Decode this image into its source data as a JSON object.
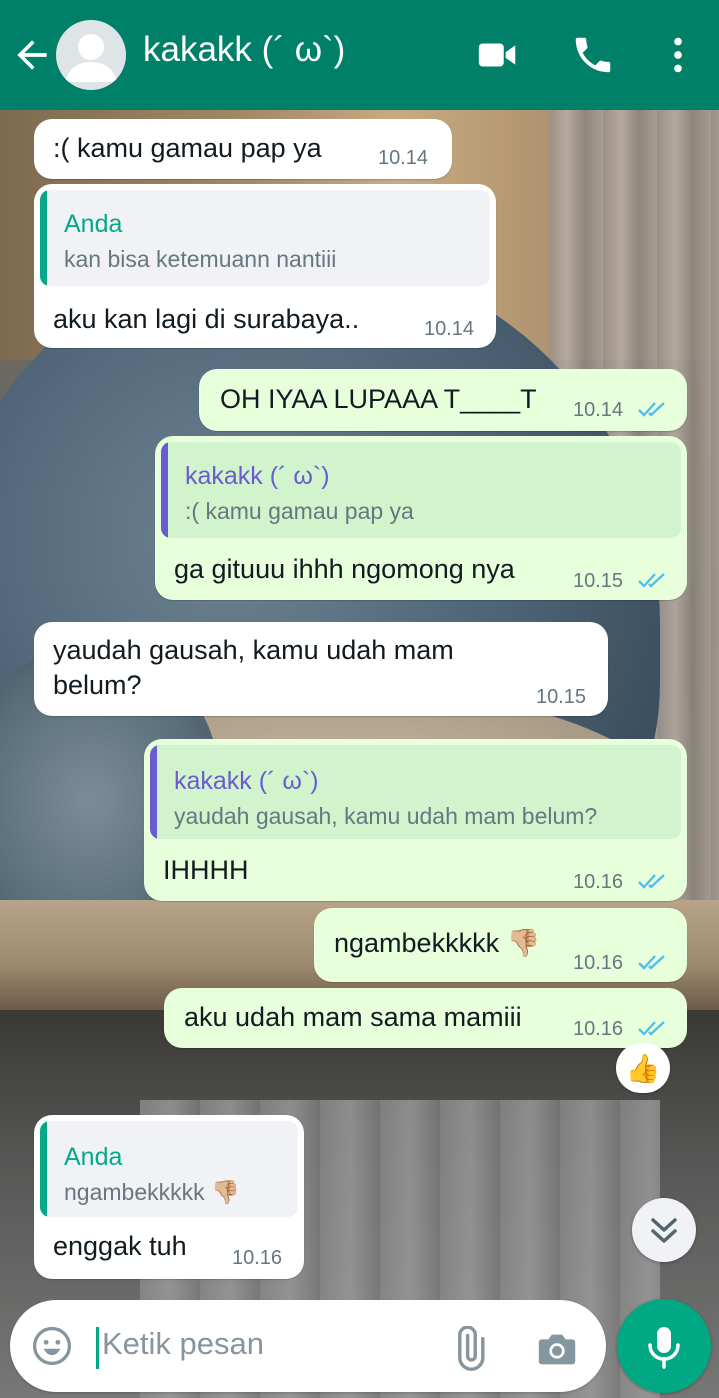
{
  "header": {
    "contact_name": "kakakk (´ ω`)",
    "icons": {
      "back": "arrow-left-icon",
      "avatar": "default-avatar-icon",
      "video": "video-camera-icon",
      "call": "phone-icon",
      "menu": "more-vertical-icon"
    }
  },
  "messages": [
    {
      "direction": "in",
      "text": ":( kamu gamau pap ya",
      "time": "10.14"
    },
    {
      "direction": "in",
      "quote": {
        "name": "Anda",
        "text": "kan bisa ketemuann nantiii"
      },
      "text": "aku kan lagi di surabaya..",
      "time": "10.14"
    },
    {
      "direction": "out",
      "text": "OH IYAA LUPAAA T____T",
      "time": "10.14",
      "status": "read"
    },
    {
      "direction": "out",
      "quote": {
        "name": "kakakk (´ ω`)",
        "text": ":( kamu gamau pap ya"
      },
      "text": "ga gituuu ihhh ngomong nya",
      "time": "10.15",
      "status": "read"
    },
    {
      "direction": "in",
      "text_lines": [
        "yaudah gausah, kamu udah mam",
        "belum?"
      ],
      "time": "10.15"
    },
    {
      "direction": "out",
      "quote": {
        "name": "kakakk (´ ω`)",
        "text": "yaudah gausah, kamu udah mam belum?"
      },
      "text": "IHHHH",
      "time": "10.16",
      "status": "read"
    },
    {
      "direction": "out",
      "text": "ngambekkkkk 👎🏼",
      "time": "10.16",
      "status": "read"
    },
    {
      "direction": "out",
      "text": "aku udah mam sama mamiii",
      "time": "10.16",
      "status": "read",
      "reaction": "👍"
    },
    {
      "direction": "in",
      "quote": {
        "name": "Anda",
        "text": "ngambekkkkk 👎🏼"
      },
      "text": "enggak tuh",
      "time": "10.16"
    }
  ],
  "input": {
    "placeholder": "Ketik pesan",
    "icons": {
      "emoji": "emoji-icon",
      "attach": "paperclip-icon",
      "camera": "camera-icon",
      "mic": "microphone-icon"
    }
  },
  "scroll_down_icon": "double-chevron-down-icon",
  "colors": {
    "header": "#008069",
    "outgoing_bubble": "#e7ffdb",
    "incoming_bubble": "#ffffff",
    "accent": "#00a884",
    "read_ticks": "#53bdeb",
    "quote_self": "#06a88a",
    "quote_other": "#6b5bd2"
  }
}
